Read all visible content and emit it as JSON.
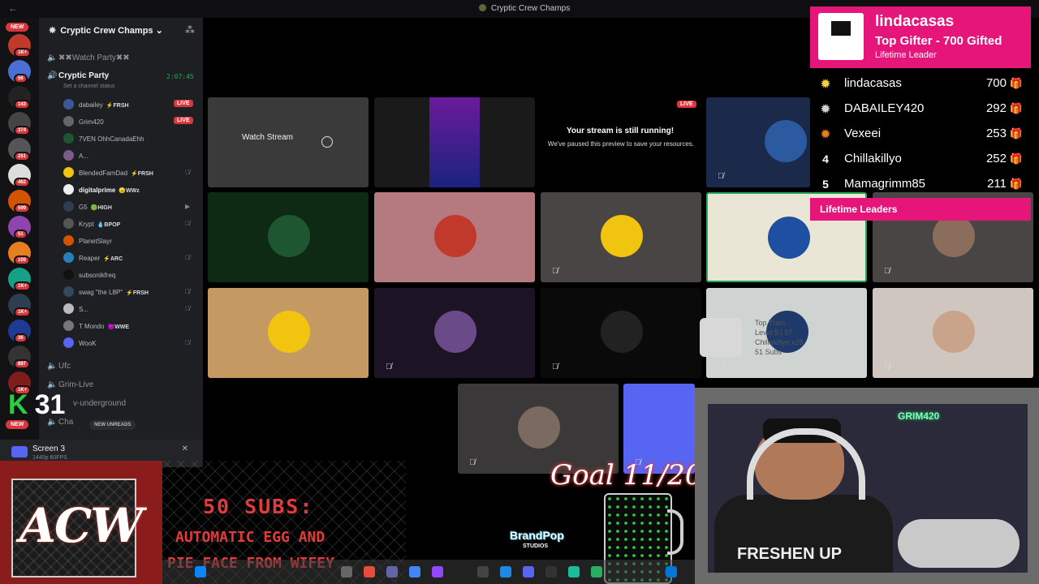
{
  "window": {
    "title": "Cryptic Crew Champs"
  },
  "rail": {
    "new_label": "NEW",
    "badges": [
      "1K+",
      "56",
      "143",
      "374",
      "251",
      "462",
      "599",
      "51",
      "109",
      "1K+",
      "1K+",
      "36",
      "897",
      "1K+"
    ],
    "bottom_new_label": "NEW"
  },
  "sidebar": {
    "guild_name": "Cryptic Crew Champs",
    "channels": [
      {
        "name": "✖✖Watch Party✖✖"
      },
      {
        "name": "Cryptic Party",
        "active": true,
        "timer": "2:07:45",
        "status": "Set a channel status"
      }
    ],
    "voice_users": [
      {
        "name": "dabailey",
        "tag": "⚡FRSH",
        "live": true
      },
      {
        "name": "Grim420",
        "live": true
      },
      {
        "name": "7VEN OhhCanadaEhh"
      },
      {
        "name": "A..."
      },
      {
        "name": "BlendedFamDad",
        "tag": "⚡FRSH"
      },
      {
        "name": "digitalprime",
        "tag": "😠WWz",
        "bold": true
      },
      {
        "name": "G5",
        "tag": "🟢HIGH"
      },
      {
        "name": "Krypt",
        "tag": "💧BPOP"
      },
      {
        "name": "PlanetSlayr"
      },
      {
        "name": "Reaper",
        "tag": "⚡ARC"
      },
      {
        "name": "subsonikfreq"
      },
      {
        "name": "swag \"the L8P\"",
        "tag": "⚡FRSH"
      },
      {
        "name": "S..."
      },
      {
        "name": "T Mondo",
        "tag": "😈WWE"
      },
      {
        "name": "WooK"
      }
    ],
    "more_channels": [
      "Ufc",
      "Grim-Live",
      "v-underground",
      "Cha"
    ],
    "new_unreads": "NEW UNREADS",
    "sub_count": "31"
  },
  "screen_share": {
    "label": "Screen 3",
    "resolution": "1440p 60FPS"
  },
  "stage": {
    "watch_stream": "Watch Stream",
    "live": "LIVE",
    "paused_title": "Your stream is still running!",
    "paused_body": "We've paused this preview to save your resources."
  },
  "overlay": {
    "sub_goal": "50 SUBS:",
    "line2": "AUTOMATIC EGG AND",
    "line3": "PIE FACE FROM WIFEY",
    "goal": "Goal 11/20",
    "brand_line1": "BrandPop",
    "brand_line2": "STUDIOS",
    "acw": "ACW",
    "shirt": "FRESHEN UP",
    "neon": "GRIM420",
    "train_line1": "Top Train",
    "train_line2": "Level 5 | 97",
    "train_line3": "Chillakillyo x25",
    "train_line4": "51 Subs"
  },
  "leaderboard": {
    "top_name": "lindacasas",
    "top_line": "Top Gifter - 700 Gifted",
    "top_sub": "Lifetime Leader",
    "rows": [
      {
        "rank": "",
        "name": "lindacasas",
        "value": "700"
      },
      {
        "rank": "",
        "name": "DABAILEY420",
        "value": "292"
      },
      {
        "rank": "",
        "name": "Vexeei",
        "value": "253"
      },
      {
        "rank": "4",
        "name": "Chillakillyo",
        "value": "252"
      },
      {
        "rank": "5",
        "name": "Mamagrimm85",
        "value": "211"
      }
    ],
    "footer": "Lifetime Leaders"
  },
  "colors": {
    "accent_pink": "#e5157a",
    "live_red": "#da373c",
    "online_green": "#23a55a"
  }
}
